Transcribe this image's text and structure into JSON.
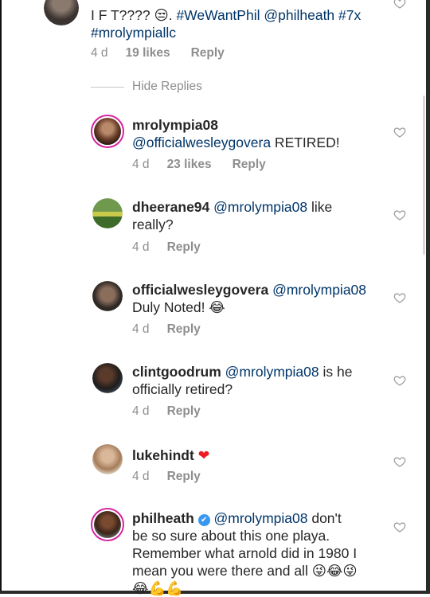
{
  "top_comment": {
    "text_start": "I F T???? ",
    "emoji": "😒",
    "text_mid": ". ",
    "tag1": "#WeWantPhil",
    "mention1": "@philheath",
    "tag2": "#7x",
    "tag3": "#mrolympiallc",
    "time": "4 d",
    "likes": "19 likes",
    "reply": "Reply"
  },
  "hide_replies": "Hide Replies",
  "replies": [
    {
      "username": "mrolympia08",
      "mention": "@officialwesleygovera",
      "text": " RETIRED!",
      "time": "4 d",
      "likes": "23 likes",
      "reply": "Reply"
    },
    {
      "username": "dheerane94",
      "mention": "@mrolympia08",
      "text_line1": " like",
      "text_line2": "really?",
      "time": "4 d",
      "reply": "Reply"
    },
    {
      "username": "officialwesleygovera",
      "mention": "@mrolympia08",
      "text_line2": "Duly Noted! ",
      "emoji": "😂",
      "time": "4 d",
      "reply": "Reply"
    },
    {
      "username": "clintgoodrum",
      "mention": "@mrolympia08",
      "text_line1": " is he",
      "text_line2": "officially retired?",
      "time": "4 d",
      "reply": "Reply"
    },
    {
      "username": "lukehindt",
      "emoji": "❤",
      "time": "4 d",
      "reply": "Reply"
    },
    {
      "username": "philheath",
      "verified_glyph": "✔",
      "mention": "@mrolympia08",
      "text_line1": " don't",
      "text_line2": "be so sure about this one playa.",
      "text_line3": "Remember what arnold did in 1980 I",
      "text_line4": "mean you were there and all ",
      "emoji_line4": "😜😂😜",
      "emoji_line5": "😂💪💪"
    }
  ],
  "icons": {
    "like": "heart-outline-icon",
    "verified": "verified-badge-icon"
  },
  "colors": {
    "mention": "#003569",
    "meta": "#8e8e8e",
    "story_ring": "#d6249f",
    "verified": "#3897f0"
  }
}
